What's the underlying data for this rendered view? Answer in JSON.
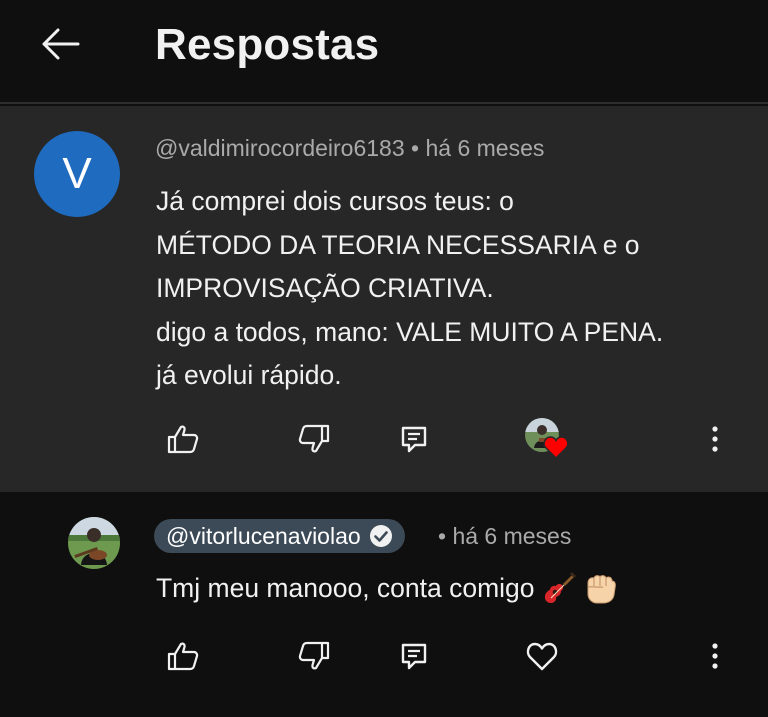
{
  "header": {
    "title": "Respostas"
  },
  "parent_comment": {
    "avatar_letter": "V",
    "avatar_color": "#1f6bbf",
    "author": "@valdimirocordeiro6183",
    "separator": "•",
    "time": "há 6 meses",
    "lines": [
      "Já comprei dois cursos teus: o",
      "MÉTODO DA TEORIA NECESSARIA e o",
      "IMPROVISAÇÃO CRIATIVA.",
      "digo a todos, mano: VALE MUITO A PENA.",
      "já evolui rápido."
    ],
    "icons": [
      "like-icon",
      "dislike-icon",
      "reply-icon",
      "creator-heart-icon",
      "more-icon"
    ]
  },
  "reply_comment": {
    "author": "@vitorlucenaviolao",
    "verified": true,
    "separator": "•",
    "time": "há 6 meses",
    "text": "Tmj meu manooo, conta comigo",
    "emojis": [
      "guitar-emoji",
      "fist-emoji"
    ],
    "icons": [
      "like-icon",
      "dislike-icon",
      "reply-icon",
      "heart-outline-icon",
      "more-icon"
    ]
  },
  "colors": {
    "background": "#0f0f0f",
    "highlight": "#272727",
    "secondary_text": "#aaaaaa",
    "chip": "#3c4a57",
    "heart": "#ff0000"
  }
}
